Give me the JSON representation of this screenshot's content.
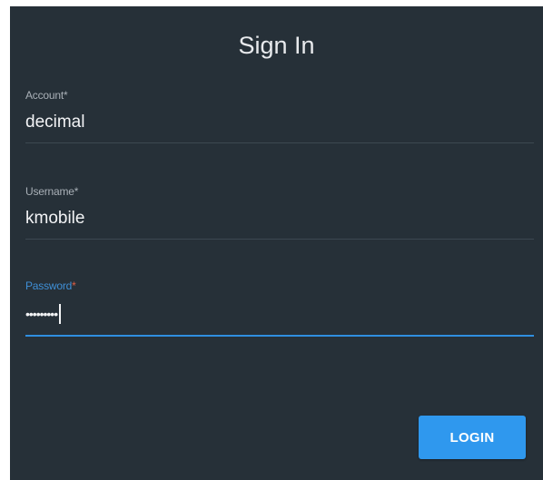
{
  "dialog": {
    "title": "Sign In"
  },
  "fields": {
    "account": {
      "label": "Account",
      "required_mark": "*",
      "value": "decimal"
    },
    "username": {
      "label": "Username",
      "required_mark": "*",
      "value": "kmobile"
    },
    "password": {
      "label": "Password",
      "required_mark": "*",
      "value": "•••••••••",
      "focused": true
    }
  },
  "actions": {
    "login_label": "LOGIN"
  },
  "colors": {
    "background": "#263038",
    "accent": "#2f98ee",
    "focus_label": "#3f8fd6",
    "required_focused": "#e05d44"
  }
}
